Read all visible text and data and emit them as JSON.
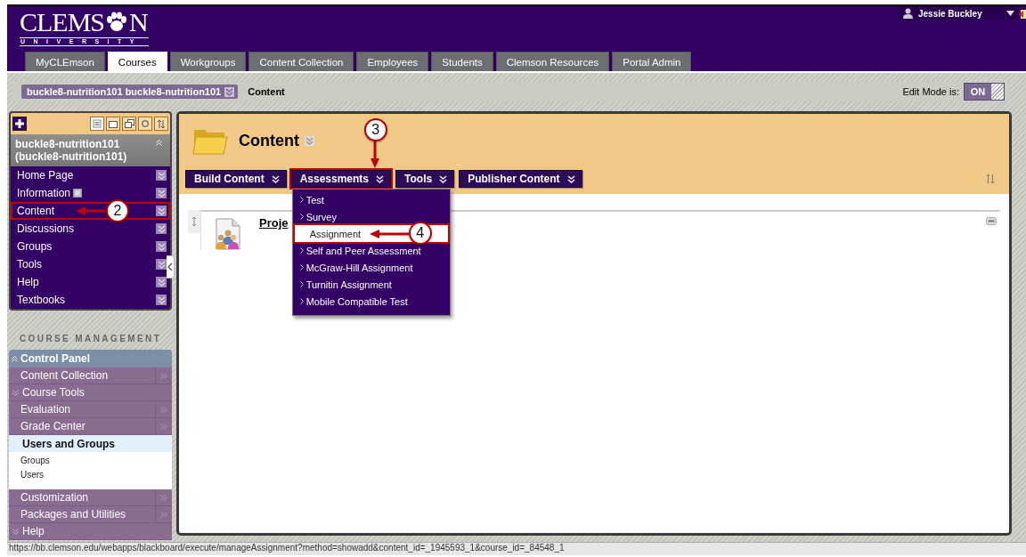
{
  "header": {
    "logo_text": "CLEMS",
    "logo_text_end": "N",
    "logo_subtitle": "UNIVERSITY",
    "user_name": "Jessie Buckley"
  },
  "tabs": [
    {
      "label": "MyCLEmson",
      "selected": false
    },
    {
      "label": "Courses",
      "selected": true
    },
    {
      "label": "Workgroups",
      "selected": false
    },
    {
      "label": "Content Collection",
      "selected": false
    },
    {
      "label": "Employees",
      "selected": false
    },
    {
      "label": "Students",
      "selected": false
    },
    {
      "label": "Clemson Resources",
      "selected": false
    },
    {
      "label": "Portal Admin",
      "selected": false
    }
  ],
  "breadcrumb": {
    "course": "buckle8-nutrition101 buckle8-nutrition101",
    "page": "Content"
  },
  "edit_mode": {
    "label": "Edit Mode is:",
    "value": "ON",
    "on": true
  },
  "course_menu": {
    "title": "buckle8-nutrition101 (buckle8-nutrition101)",
    "items": [
      {
        "label": "Home Page",
        "highlighted": false
      },
      {
        "label": "Information",
        "highlighted": false,
        "kind": "info"
      },
      {
        "label": "Content",
        "highlighted": true,
        "callout": "2"
      },
      {
        "label": "Discussions",
        "highlighted": false
      },
      {
        "label": "Groups",
        "highlighted": false
      },
      {
        "label": "Tools",
        "highlighted": false
      },
      {
        "label": "Help",
        "highlighted": false
      },
      {
        "label": "Textbooks",
        "highlighted": false
      }
    ]
  },
  "course_management": {
    "heading": "COURSE MANAGEMENT",
    "panel_title": "Control Panel",
    "items": [
      {
        "label": "Content Collection",
        "kind": "link"
      },
      {
        "label": "Course Tools",
        "kind": "section",
        "expanded": false
      },
      {
        "label": "Evaluation",
        "kind": "link"
      },
      {
        "label": "Grade Center",
        "kind": "link"
      },
      {
        "label": "Users and Groups",
        "kind": "section",
        "expanded": true,
        "children": [
          {
            "label": "Groups"
          },
          {
            "label": "Users"
          }
        ]
      },
      {
        "label": "Customization",
        "kind": "link"
      },
      {
        "label": "Packages and Utilities",
        "kind": "link"
      },
      {
        "label": "Help",
        "kind": "section",
        "expanded": false
      }
    ]
  },
  "content": {
    "title": "Content",
    "actions": [
      {
        "label": "Build Content",
        "highlighted": false
      },
      {
        "label": "Assessments",
        "highlighted": true,
        "callout": "3",
        "open": true
      },
      {
        "label": "Tools",
        "highlighted": false
      },
      {
        "label": "Publisher Content",
        "highlighted": false
      }
    ],
    "menu": [
      {
        "label": "Test",
        "highlighted": false
      },
      {
        "label": "Survey",
        "highlighted": false
      },
      {
        "label": "Assignment",
        "highlighted": true,
        "callout": "4"
      },
      {
        "label": "Self and Peer Assessment",
        "highlighted": false
      },
      {
        "label": "McGraw-Hill Assignment",
        "highlighted": false
      },
      {
        "label": "Turnitin Assignment",
        "highlighted": false
      },
      {
        "label": "Mobile Compatible Test",
        "highlighted": false
      }
    ],
    "items": [
      {
        "title": "Proje"
      }
    ]
  },
  "status_bar": {
    "url": "https://bb.clemson.edu/webapps/blackboard/execute/manageAssignment?method=showadd&content_id=_1945593_1&course_id=_84548_1"
  }
}
